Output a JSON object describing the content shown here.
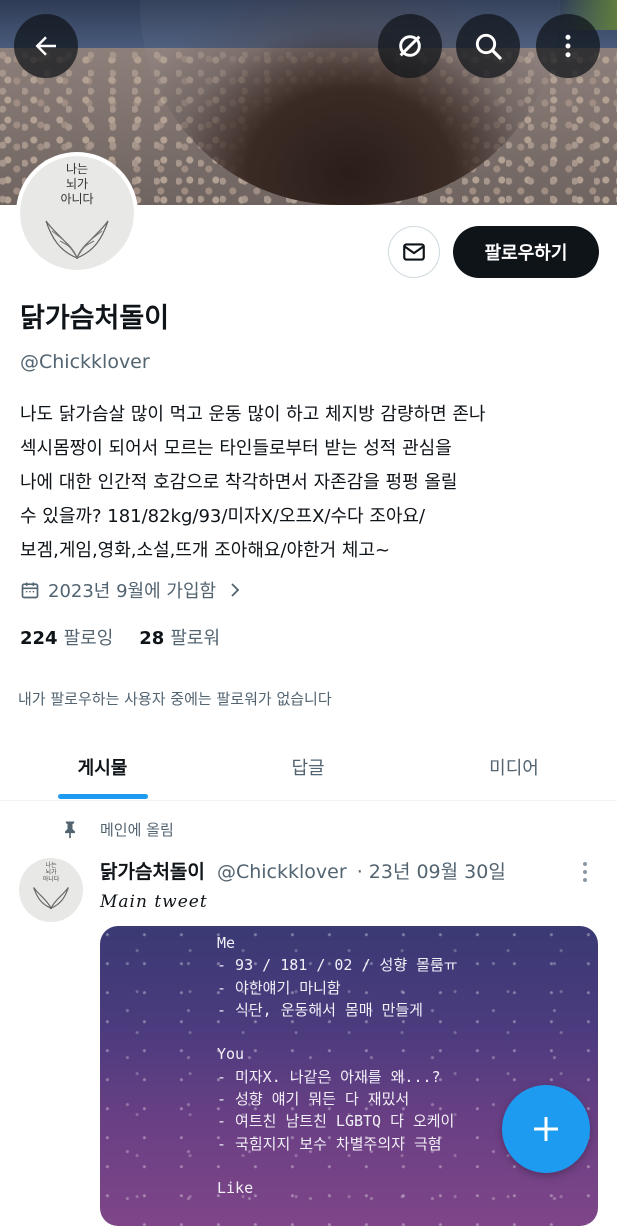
{
  "profile": {
    "name": "닭가슴처돌이",
    "handle": "@Chickklover",
    "bio_lines": [
      "나도 닭가슴살 많이 먹고 운동 많이 하고 체지방 감량하면 존나",
      "섹시몸짱이 되어서 모르는 타인들로부터 받는 성적 관심을",
      "나에 대한 인간적 호감으로 착각하면서 자존감을 펑펑 올릴",
      "수 있을까?  181/82kg/93/미자X/오프X/수다 조아요/",
      "보겜,게임,영화,소설,뜨개 조아해요/야한거 체고~"
    ],
    "joined": "2023년 9월에 가입함",
    "following_count": "224",
    "following_label": "팔로잉",
    "followers_count": "28",
    "followers_label": "팔로워",
    "mutual_note": "내가 팔로우하는 사용자 중에는 팔로워가 없습니다",
    "follow_button": "팔로우하기",
    "avatar_text": [
      "나는",
      "뇌가",
      "아니다"
    ]
  },
  "icons": {
    "back": "arrow-left-icon",
    "mute": "slashed-circle-icon",
    "search": "search-icon",
    "more": "more-vertical-icon",
    "message": "envelope-icon",
    "calendar": "calendar-icon",
    "chevron": "chevron-right-icon",
    "pin": "pin-icon",
    "compose": "plus-icon"
  },
  "tabs": [
    {
      "label": "게시물",
      "active": true
    },
    {
      "label": "답글",
      "active": false
    },
    {
      "label": "미디어",
      "active": false
    }
  ],
  "pinned_post": {
    "pinned_label": "메인에 올림",
    "author_name": "닭가슴처돌이",
    "author_handle": "@Chickklover",
    "meta": "· 23년 09월 30일",
    "subtitle": "Main tweet",
    "media_lines": [
      "Me",
      "- 93 / 181 / 02 / 성향 몰룸ㅠ",
      "- 야한얘기 마니함",
      "- 식단, 운동해서 몸매 만들게",
      "",
      "You",
      "- 미자X. 나같은 아재를 왜...?",
      "- 성향 얘기 뭐든 다 재밌서",
      "- 여트친 남트친 LGBTQ 다 오케이",
      "- 국힘지지 보수 차별주의자 극혐",
      "",
      "Like"
    ]
  },
  "colors": {
    "accent": "#1d9bf0",
    "text_primary": "#0f1419",
    "text_secondary": "#536471",
    "follow_button_bg": "#0f1419"
  }
}
